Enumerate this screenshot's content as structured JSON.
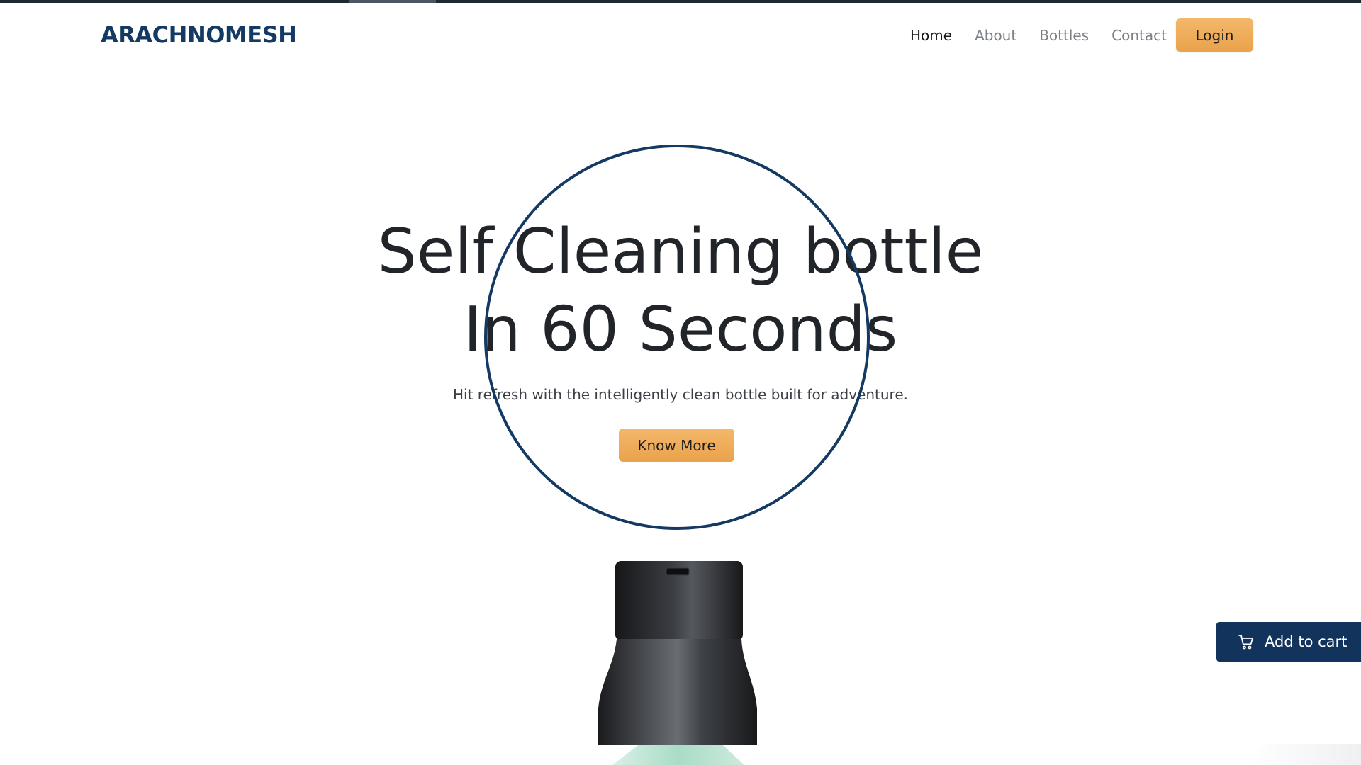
{
  "brand": {
    "name": "ARACHNOMESH",
    "color": "#143a63"
  },
  "nav": {
    "items": [
      {
        "label": "Home",
        "active": true
      },
      {
        "label": "About",
        "active": false
      },
      {
        "label": "Bottles",
        "active": false
      },
      {
        "label": "Contact",
        "active": false
      }
    ],
    "login_label": "Login"
  },
  "hero": {
    "title_line1": "Self Cleaning bottle",
    "title_line2": "In 60 Seconds",
    "subtitle": "Hit refresh with the intelligently clean bottle built for adventure.",
    "cta_label": "Know More"
  },
  "cart": {
    "label": "Add to cart",
    "icon": "cart-icon"
  },
  "colors": {
    "accent": "#eaa24b",
    "navy": "#12345c",
    "ring": "#143a63",
    "text_dark": "#212428",
    "nav_inactive": "#7b8087"
  }
}
